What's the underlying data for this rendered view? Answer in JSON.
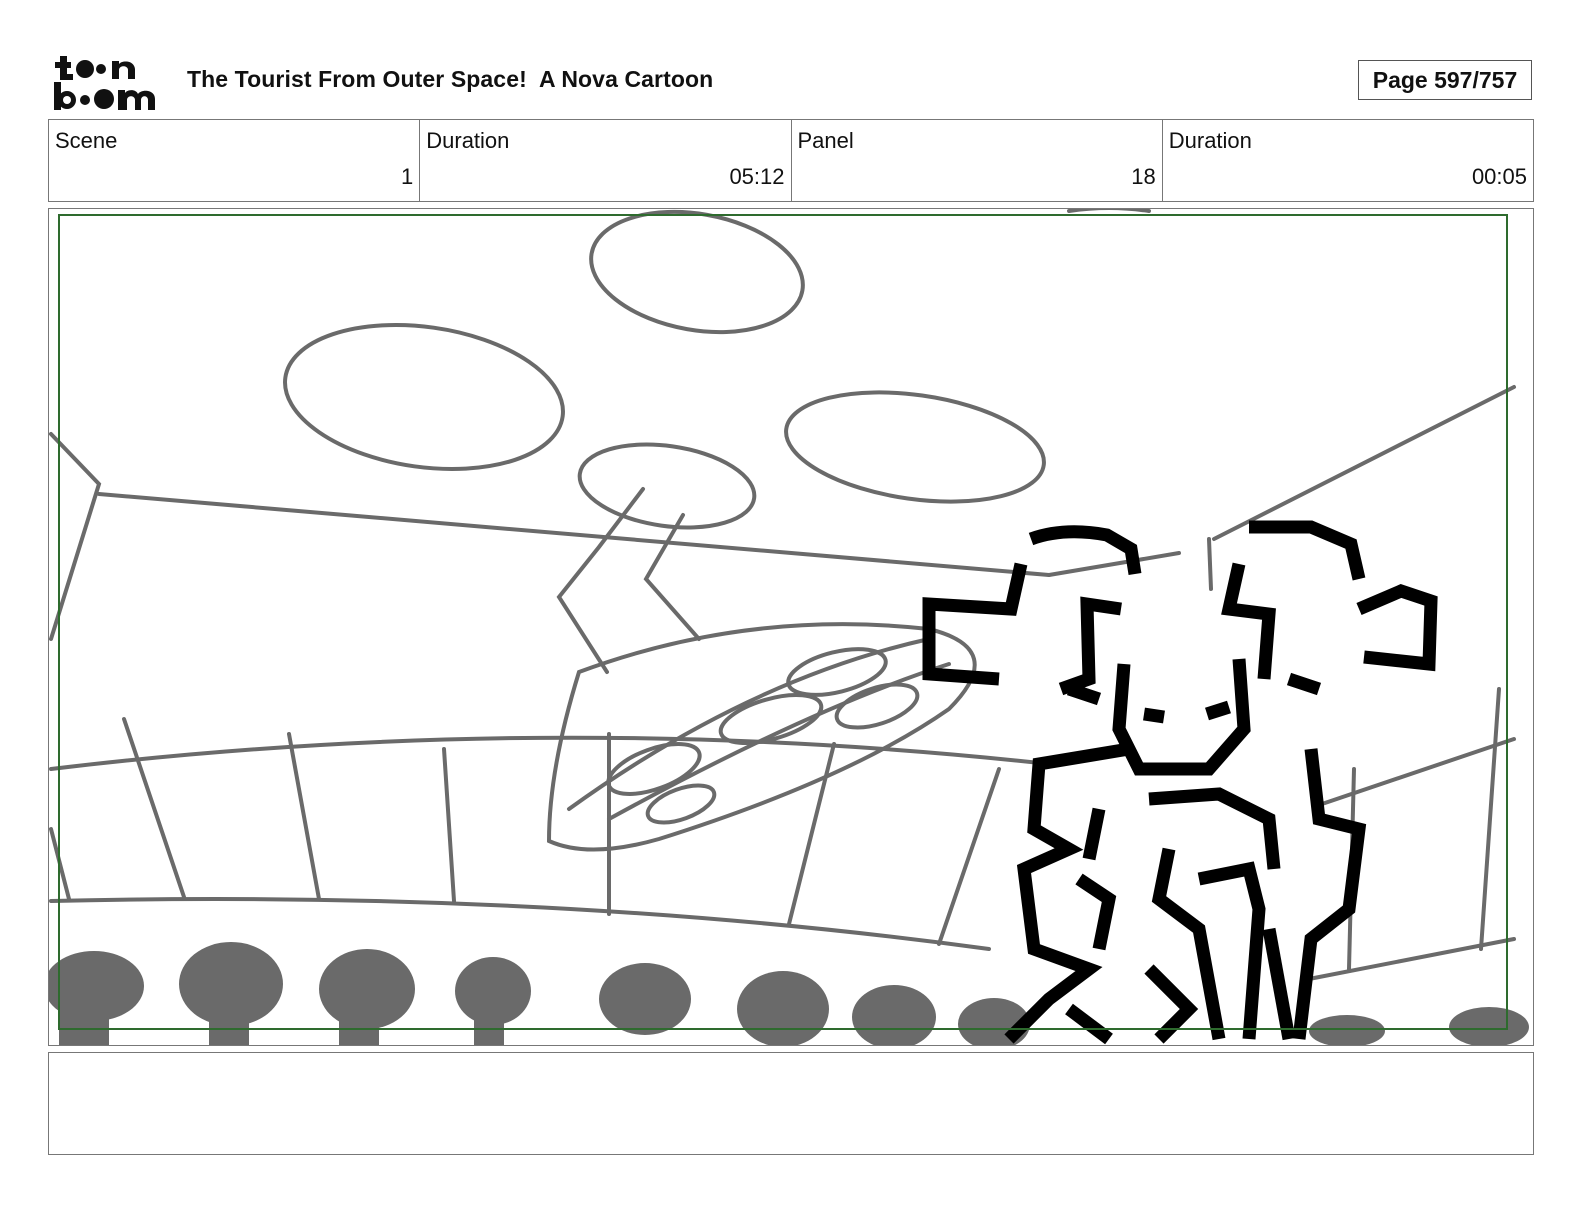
{
  "header": {
    "logo": {
      "icon": "toonboom-logo",
      "text": "toon boom"
    },
    "title": "The Tourist From Outer Space!  A Nova Cartoon",
    "page": "Page 597/757"
  },
  "info": {
    "scene_label": "Scene",
    "scene_value": "1",
    "scene_duration_label": "Duration",
    "scene_duration_value": "05:12",
    "panel_label": "Panel",
    "panel_value": "18",
    "panel_duration_label": "Duration",
    "panel_duration_value": "00:05"
  },
  "panel": {
    "image": "storyboard-sketch",
    "safe_frame_color": "#2e6b2e",
    "sketch_color": "#6a6a6a",
    "character_color": "#000000"
  },
  "notes": {
    "text": ""
  }
}
